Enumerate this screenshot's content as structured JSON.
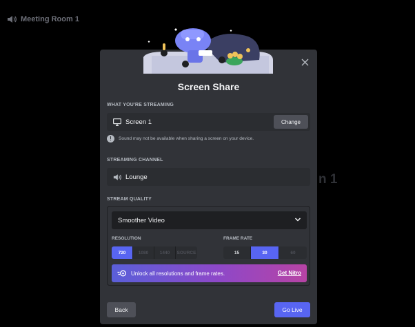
{
  "background": {
    "channel_name": "Meeting Room 1",
    "ghost_text": "n 1"
  },
  "modal": {
    "title": "Screen Share",
    "streaming": {
      "label": "WHAT YOU'RE STREAMING",
      "source": "Screen 1",
      "change_label": "Change",
      "warning": "Sound may not be available when sharing a screen on your device."
    },
    "channel": {
      "label": "STREAMING CHANNEL",
      "name": "Lounge"
    },
    "quality": {
      "label": "STREAM QUALITY",
      "preset": "Smoother Video",
      "resolution_label": "RESOLUTION",
      "resolutions": [
        "720",
        "1080",
        "1440",
        "SOURCE"
      ],
      "selected_resolution": "720",
      "frame_rate_label": "FRAME RATE",
      "frame_rates": [
        "15",
        "30",
        "60"
      ],
      "selected_frame_rate": "30",
      "nitro_text": "Unlock all resolutions and frame rates.",
      "nitro_link": "Get Nitro"
    },
    "footer": {
      "back_label": "Back",
      "go_live_label": "Go Live"
    }
  },
  "colors": {
    "accent": "#5865f2",
    "modal_bg": "#313338",
    "field_bg": "#2b2d31",
    "button_gray": "#4e5058"
  },
  "icons": [
    "speaker-icon",
    "close-icon",
    "monitor-icon",
    "info-icon",
    "chevron-down-icon",
    "nitro-icon"
  ]
}
